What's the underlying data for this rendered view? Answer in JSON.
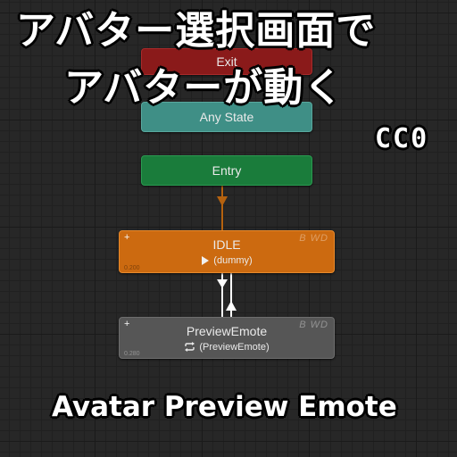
{
  "overlay": {
    "title_line1": "アバター選択画面で",
    "title_line2": "アバターが動く",
    "license": "CC0",
    "subtitle": "Avatar Preview Emote"
  },
  "states": {
    "exit": {
      "label": "Exit",
      "color": "#8a1a1a"
    },
    "any_state": {
      "label": "Any State",
      "color": "#3f8f86"
    },
    "entry": {
      "label": "Entry",
      "color": "#1a7c3b"
    },
    "idle": {
      "label": "IDLE",
      "motion": "(dummy)",
      "motion_icon": "play-icon",
      "plus": "+",
      "tag": "B WD",
      "number": "0.200",
      "color": "#cc6a10"
    },
    "preview": {
      "label": "PreviewEmote",
      "motion": "(PreviewEmote)",
      "motion_icon": "loop-icon",
      "plus": "+",
      "tag": "B WD",
      "number": "0.280",
      "color": "#565656"
    }
  }
}
